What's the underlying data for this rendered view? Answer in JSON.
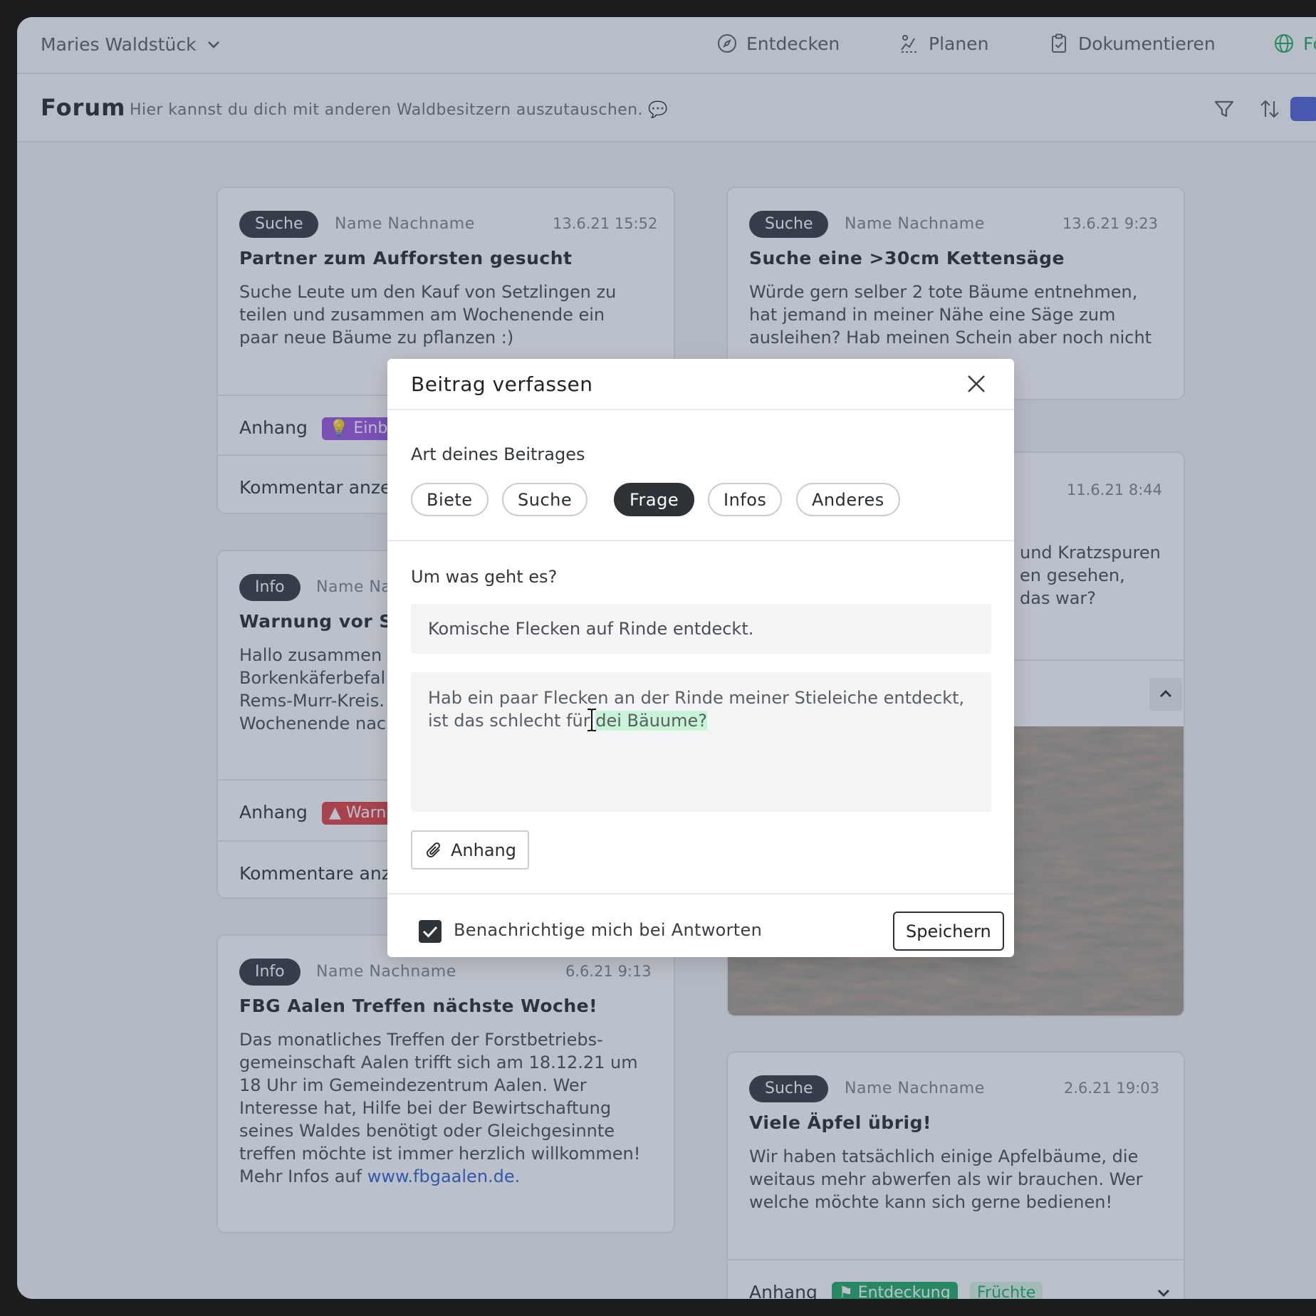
{
  "app": {
    "workspace": "Maries Waldstück",
    "nav": [
      {
        "label": "Entdecken",
        "icon": "compass-icon"
      },
      {
        "label": "Planen",
        "icon": "plan-icon"
      },
      {
        "label": "Dokumentieren",
        "icon": "clipboard-icon"
      },
      {
        "label": "Fo",
        "icon": "globe-icon"
      }
    ]
  },
  "forum": {
    "title": "Forum",
    "subtitle": "Hier kannst du dich mit anderen Waldbesitzern auszutauschen. 💬"
  },
  "posts": [
    {
      "badge": "Suche",
      "author": "Name Nachname",
      "date": "13.6.21  15:52",
      "title": "Partner zum Aufforsten gesucht",
      "body": [
        "Suche Leute um den Kauf von Setzlingen zu",
        "teilen und zusammen am Wochenende ein",
        "paar neue Bäume zu pflanzen :)"
      ],
      "attach_label": "Anhang",
      "tag": "💡 Einbl",
      "comments": "Kommentar anze"
    },
    {
      "badge": "Suche",
      "author": "Name Nachname",
      "date": "13.6.21  9:23",
      "title": "Suche eine >30cm Kettensäge",
      "body": [
        "Würde gern selber 2 tote Bäume entnehmen,",
        "hat jemand in meiner Nähe eine Säge zum",
        "ausleihen? Hab meinen Schein aber noch nicht"
      ]
    },
    {
      "badge": "Info",
      "author": "Name Na",
      "title": "Warnung vor S",
      "body": [
        "Hallo zusammen",
        "Borkenkäferbefal",
        "Rems-Murr-Kreis.",
        "Wochenende nac"
      ],
      "attach_label": "Anhang",
      "tag": "▲ Warn",
      "comments": "Kommentare anz"
    },
    {
      "date": "11.6.21  8:44",
      "body": [
        "und Kratzspuren",
        "en gesehen,",
        "das war?"
      ]
    },
    {
      "badge": "Info",
      "author": "Name Nachname",
      "date": "6.6.21  9:13",
      "title": "FBG Aalen Treffen nächste Woche!",
      "body": [
        "Das monatliches Treffen der Forstbetriebs-",
        "gemeinschaft Aalen trifft sich am 18.12.21 um",
        "18 Uhr im Gemeindezentrum Aalen. Wer",
        "Interesse hat, Hilfe bei der Bewirtschaftung",
        "seines Waldes benötigt oder Gleichgesinnte",
        "treffen möchte ist immer herzlich willkommen!"
      ],
      "body_last_prefix": "Mehr Infos auf ",
      "link": "www.fbgaalen.de."
    },
    {
      "badge": "Suche",
      "author": "Name Nachname",
      "date": "2.6.21  19:03",
      "title": "Viele Äpfel übrig!",
      "body": [
        "Wir haben tatsächlich einige Apfelbäume, die",
        "weitaus mehr abwerfen als wir brauchen. Wer",
        "welche möchte kann sich gerne bedienen!"
      ],
      "attach_label": "Anhang",
      "tags": [
        "⚑ Entdeckung",
        "Früchte"
      ]
    }
  ],
  "modal": {
    "title": "Beitrag verfassen",
    "type_label": "Art deines Beitrages",
    "types": [
      "Biete",
      "Suche",
      "Frage",
      "Infos",
      "Anderes"
    ],
    "selected_type": "Frage",
    "topic_label": "Um was geht es?",
    "title_value": "Komische Flecken auf Rinde entdeckt.",
    "body_line1": "Hab ein paar Flecken an der Rinde meiner Stieleiche entdeckt,",
    "body_line2_plain": "ist das schlecht für ",
    "body_line2_highlight": "dei Bäuume?",
    "attach_button": "Anhang",
    "notify_label": "Benachrichtige mich bei Antworten",
    "notify_checked": true,
    "save_button": "Speichern"
  },
  "colors": {
    "badge": "#2e3338",
    "tag_purple": "#9a4fe0",
    "tag_red": "#e03a3a",
    "tag_green": "#1ca760",
    "tag_green_light": "#d8f5e3",
    "overlay": "#42546c",
    "highlight": "#c8f3d6"
  }
}
